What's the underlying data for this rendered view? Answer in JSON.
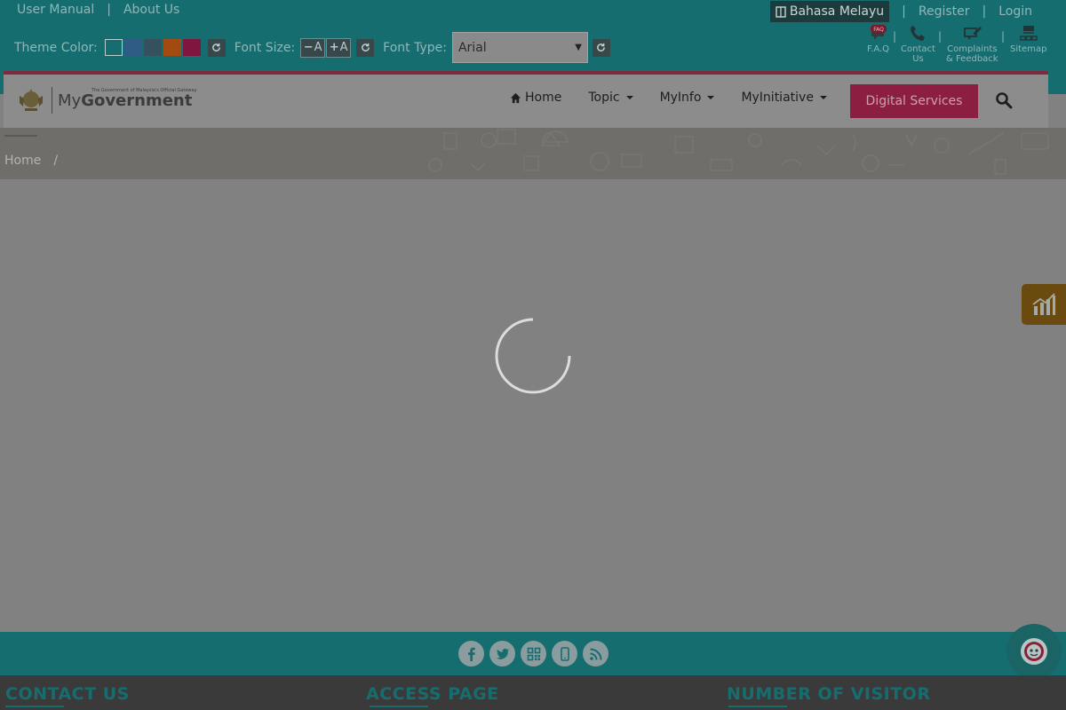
{
  "topbar": {
    "links": [
      "User Manual",
      "About Us"
    ],
    "separator": "|",
    "language_button": "Bahasa Melayu",
    "auth_links": [
      "Register",
      "Login"
    ],
    "theme_label": "Theme Color:",
    "font_size_label": "Font Size:",
    "font_minus": "A",
    "font_plus": "A",
    "font_type_label": "Font Type:",
    "font_type_value": "Arial",
    "faq_badge": "FAQ",
    "quick_links": [
      {
        "label": "F.A.Q",
        "icon": "faq-icon"
      },
      {
        "label": "Contact\nUs",
        "icon": "phone-icon"
      },
      {
        "label": "Complaints\n& Feedback",
        "icon": "complaint-icon"
      },
      {
        "label": "Sitemap",
        "icon": "sitemap-icon"
      }
    ],
    "theme_colors": [
      "#166d6f",
      "#2e5c85",
      "#35505e",
      "#a34a10",
      "#80153f"
    ]
  },
  "nav": {
    "logo_tagline": "The Government of Malaysia's Official Gateway",
    "logo_my": "My",
    "logo_gov": "Government",
    "items": [
      {
        "label": "Home",
        "icon": "home-icon"
      },
      {
        "label": "Topic"
      },
      {
        "label": "MyInfo"
      },
      {
        "label": "MyInitiative"
      }
    ],
    "digital_services": "Digital Services",
    "accent_color": "#8c1f41"
  },
  "breadcrumb": {
    "items": [
      "Home"
    ],
    "separator": "/"
  },
  "footer": {
    "social": [
      "facebook-icon",
      "twitter-icon",
      "qr-code-icon",
      "mobile-icon",
      "rss-icon"
    ],
    "headings": [
      "CONTACT US",
      "ACCESS PAGE",
      "NUMBER OF VISITOR"
    ]
  }
}
